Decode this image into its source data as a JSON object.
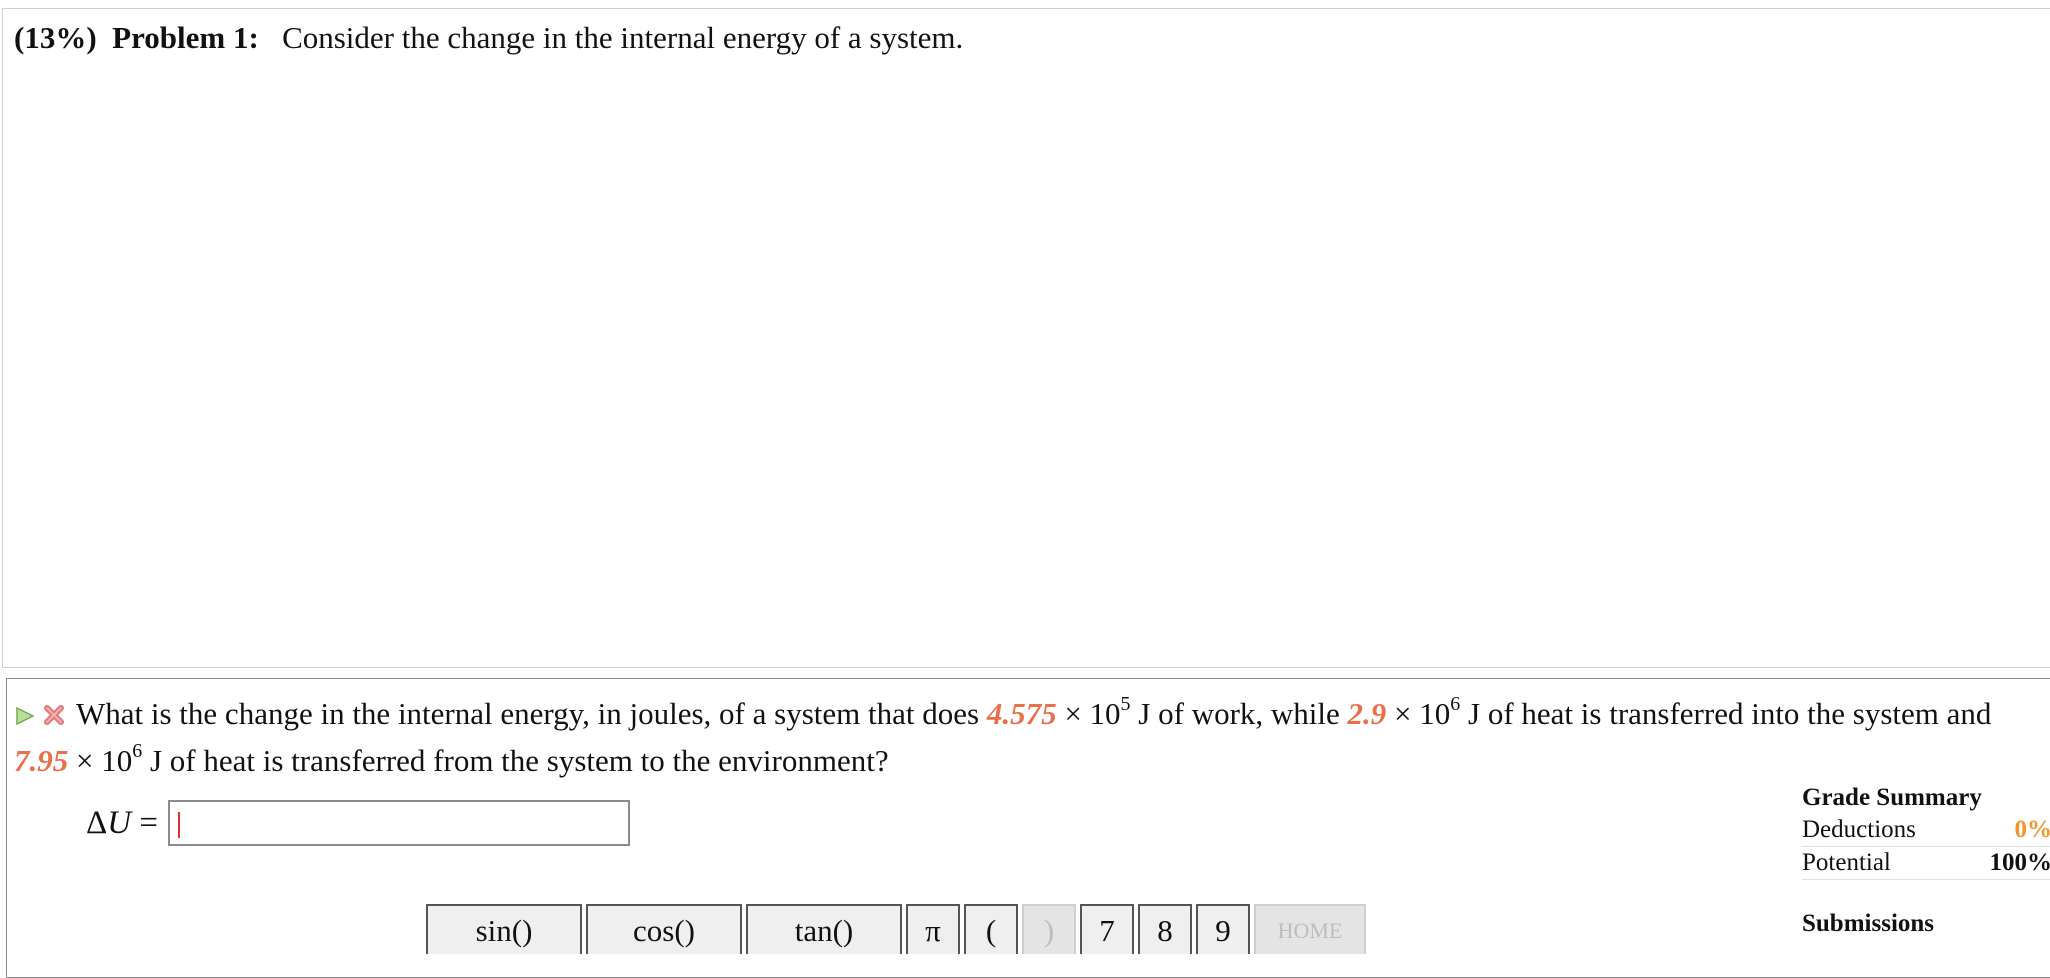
{
  "problem": {
    "percent": "(13%)",
    "title": "Problem 1:",
    "statement": "Consider the change in the internal energy of a system."
  },
  "question": {
    "text_1": "What is the change in the internal energy, in joules, of a system that does ",
    "work_value": "4.575",
    "work_times": " × 10",
    "work_exp": "5",
    "text_2": " J of work, while ",
    "heat_in_value": "2.9",
    "heat_in_times": " × 10",
    "heat_in_exp": "6",
    "text_3": " J of heat is transferred into the system and ",
    "heat_out_value": "7.95",
    "heat_out_times": " × 10",
    "heat_out_exp": "6",
    "text_4": " J of heat is transferred from the system to the environment?"
  },
  "answer": {
    "delta": "Δ",
    "symbol": "U",
    "equals": " =",
    "value": ""
  },
  "keypad": {
    "keys": [
      "sin()",
      "cos()",
      "tan()",
      "π",
      "(",
      ")",
      "7",
      "8",
      "9",
      "HOME"
    ]
  },
  "grade_summary": {
    "title": "Grade Summary",
    "deductions_label": "Deductions",
    "deductions_value": "0%",
    "potential_label": "Potential",
    "potential_value": "100%"
  },
  "submissions": {
    "title": "Submissions"
  },
  "colors": {
    "variable": "#e8704a",
    "deduction": "#f0962a",
    "caret": "#e03030"
  }
}
